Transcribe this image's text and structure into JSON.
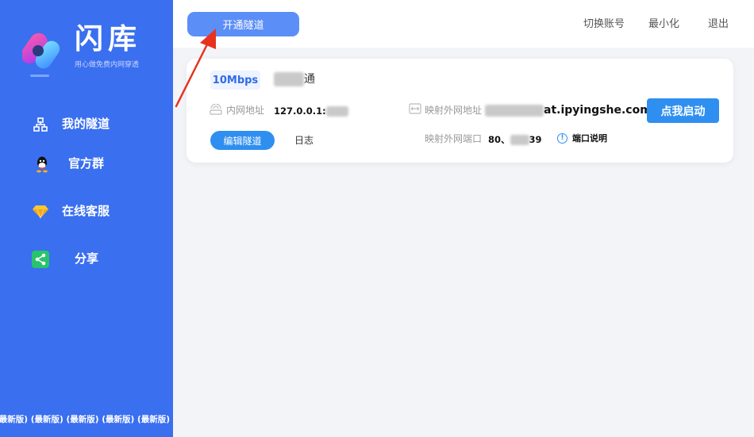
{
  "brand": {
    "title": "闪库",
    "subtitle": "用心做免费内网穿透"
  },
  "sidebar": {
    "items": [
      {
        "label": "我的隧道",
        "icon": "tunnel-icon"
      },
      {
        "label": "官方群",
        "icon": "qq-icon"
      },
      {
        "label": "在线客服",
        "icon": "diamond-icon"
      },
      {
        "label": "分享",
        "icon": "share-icon"
      }
    ],
    "version_text": "(最新版) (最新版) (最新版) (最新版) (最新版) (最"
  },
  "topbar": {
    "open_tunnel": "开通隧道",
    "switch_account": "切换账号",
    "minimize": "最小化",
    "exit": "退出"
  },
  "tunnel": {
    "bandwidth": "10Mbps",
    "name_suffix": "通",
    "internal_label": "内网地址",
    "internal_value": "127.0.0.1:",
    "mapped_label": "映射外网地址",
    "mapped_value_suffix": "at.ipyingshe.com",
    "mapped_port_label": "映射外网端口",
    "mapped_port_value_prefix": "80、",
    "mapped_port_value_suffix": "39",
    "start_button": "点我启动",
    "edit_button": "编辑隧道",
    "log_link": "日志",
    "port_help": "端口说明"
  },
  "colors": {
    "sidebar_bg": "#3a6ff0",
    "primary_button": "#2f8ff0",
    "open_button": "#5c8ef7",
    "arrow": "#e8321f"
  }
}
